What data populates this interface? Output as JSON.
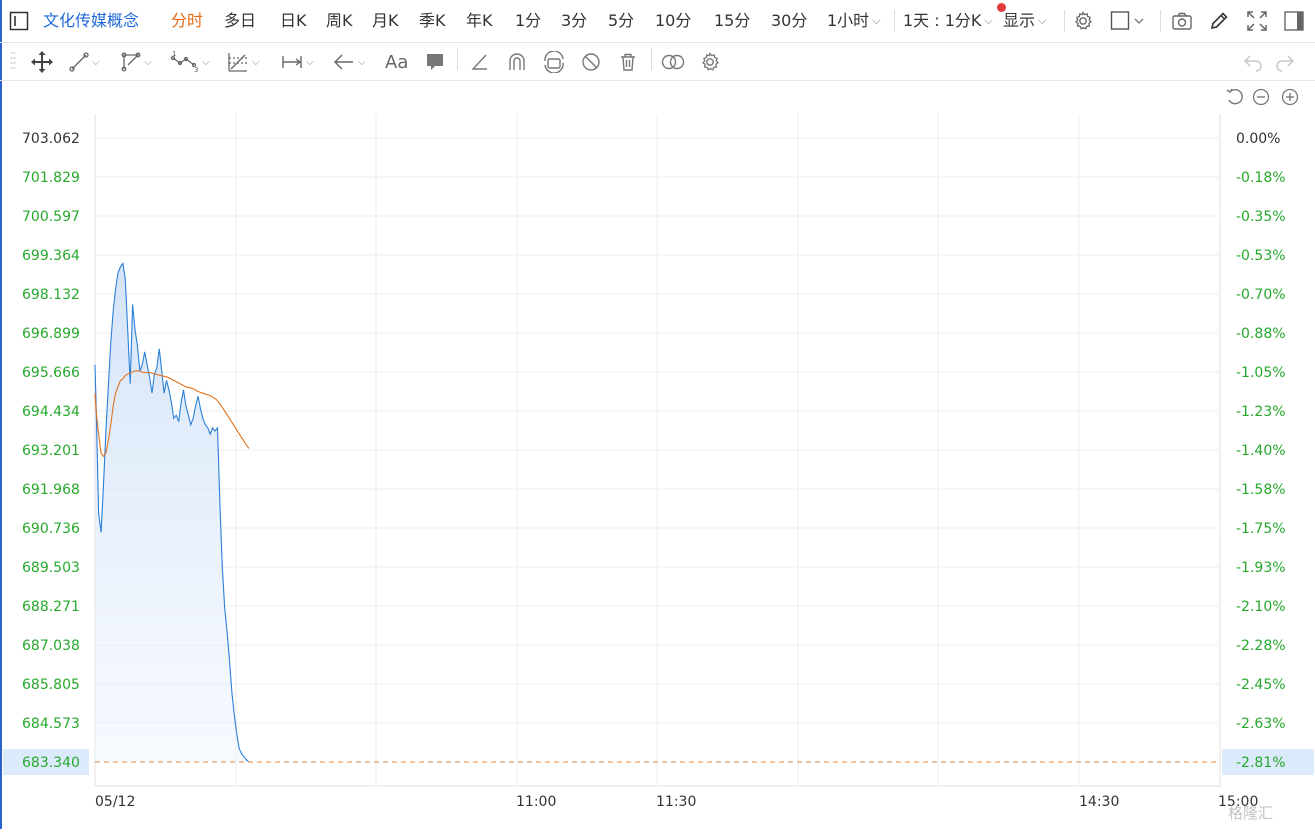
{
  "toolbar": {
    "title": "文化传媒概念",
    "tabs": [
      "分时",
      "多日",
      "日K",
      "周K",
      "月K",
      "季K",
      "年K",
      "1分",
      "3分",
      "5分",
      "10分",
      "15分",
      "30分"
    ],
    "hour_label": "1小时",
    "period_label": "1天 : 1分K",
    "display_label": "显示",
    "colors": {
      "active": "#1f6ad9",
      "selected_tab": "#e56b16",
      "badge": "#e23b3b"
    }
  },
  "drawbar": {
    "icons": [
      "move-icon",
      "line-icon",
      "path-icon",
      "wave-icon",
      "fib-icon",
      "measure-icon",
      "arrow-icon",
      "text-icon",
      "comment-icon",
      "angle-icon",
      "magnet-icon",
      "lock-icon",
      "hide-icon",
      "trash-icon",
      "compare-icon",
      "settings-icon",
      "undo-icon",
      "redo-icon"
    ],
    "text_tool": "Aa"
  },
  "chart_data": {
    "type": "line",
    "title": "",
    "y_left_ticks": [
      "703.062",
      "701.829",
      "700.597",
      "699.364",
      "698.132",
      "696.899",
      "695.666",
      "694.434",
      "693.201",
      "691.968",
      "690.736",
      "689.503",
      "688.271",
      "687.038",
      "685.805",
      "684.573",
      "683.340"
    ],
    "y_right_ticks": [
      "0.00%",
      "-0.18%",
      "-0.35%",
      "-0.53%",
      "-0.70%",
      "-0.88%",
      "-1.05%",
      "-1.23%",
      "-1.40%",
      "-1.58%",
      "-1.75%",
      "-1.93%",
      "-2.10%",
      "-2.28%",
      "-2.45%",
      "-2.63%",
      "-2.81%"
    ],
    "x_ticks": [
      "05/12",
      "11:00",
      "11:30",
      "14:30",
      "15:00"
    ],
    "ylim": [
      683.34,
      703.062
    ],
    "current_value": "683.340",
    "current_pct": "-2.81%",
    "series": [
      {
        "color": "#2b7fd8",
        "fill": true,
        "points": [
          [
            0,
            695.9
          ],
          [
            1,
            694.5
          ],
          [
            2,
            692.9
          ],
          [
            3,
            691.2
          ],
          [
            5,
            690.6
          ],
          [
            7,
            692.1
          ],
          [
            9,
            693.8
          ],
          [
            11,
            695.2
          ],
          [
            13,
            696.6
          ],
          [
            15,
            697.6
          ],
          [
            17,
            698.3
          ],
          [
            19,
            698.8
          ],
          [
            21,
            699.0
          ],
          [
            23,
            699.1
          ],
          [
            25,
            698.6
          ],
          [
            27,
            697.0
          ],
          [
            29,
            695.3
          ],
          [
            31,
            697.8
          ],
          [
            33,
            697.0
          ],
          [
            35,
            696.5
          ],
          [
            37,
            695.7
          ],
          [
            39,
            695.9
          ],
          [
            41,
            696.3
          ],
          [
            43,
            695.9
          ],
          [
            45,
            695.5
          ],
          [
            47,
            695.0
          ],
          [
            49,
            695.6
          ],
          [
            51,
            695.8
          ],
          [
            53,
            696.4
          ],
          [
            55,
            695.7
          ],
          [
            57,
            695.0
          ],
          [
            59,
            695.4
          ],
          [
            61,
            695.1
          ],
          [
            63,
            694.7
          ],
          [
            65,
            694.2
          ],
          [
            67,
            694.3
          ],
          [
            69,
            694.1
          ],
          [
            71,
            694.7
          ],
          [
            73,
            695.1
          ],
          [
            75,
            694.6
          ],
          [
            77,
            694.3
          ],
          [
            79,
            694.0
          ],
          [
            81,
            694.2
          ],
          [
            83,
            694.6
          ],
          [
            85,
            694.9
          ],
          [
            87,
            694.5
          ],
          [
            89,
            694.2
          ],
          [
            91,
            694.0
          ],
          [
            93,
            693.9
          ],
          [
            95,
            693.7
          ],
          [
            97,
            693.9
          ],
          [
            99,
            693.8
          ],
          [
            101,
            693.9
          ],
          [
            103,
            691.5
          ],
          [
            105,
            689.5
          ],
          [
            107,
            688.2
          ],
          [
            109,
            687.4
          ],
          [
            111,
            686.5
          ],
          [
            113,
            685.5
          ],
          [
            115,
            684.8
          ],
          [
            117,
            684.2
          ],
          [
            119,
            683.75
          ],
          [
            121,
            683.6
          ],
          [
            123,
            683.5
          ],
          [
            125,
            683.4
          ],
          [
            127,
            683.34
          ]
        ]
      },
      {
        "color": "#e0731f",
        "fill": false,
        "points": [
          [
            0,
            695.0
          ],
          [
            1,
            694.4
          ],
          [
            3,
            693.7
          ],
          [
            5,
            693.1
          ],
          [
            7,
            693.0
          ],
          [
            9,
            693.1
          ],
          [
            11,
            693.5
          ],
          [
            13,
            694.0
          ],
          [
            15,
            694.6
          ],
          [
            17,
            695.0
          ],
          [
            19,
            695.2
          ],
          [
            21,
            695.4
          ],
          [
            23,
            695.45
          ],
          [
            25,
            695.55
          ],
          [
            27,
            695.6
          ],
          [
            30,
            695.65
          ],
          [
            33,
            695.7
          ],
          [
            36,
            695.7
          ],
          [
            40,
            695.65
          ],
          [
            45,
            695.65
          ],
          [
            50,
            695.6
          ],
          [
            55,
            695.55
          ],
          [
            60,
            695.5
          ],
          [
            65,
            695.4
          ],
          [
            70,
            695.3
          ],
          [
            75,
            695.2
          ],
          [
            80,
            695.15
          ],
          [
            85,
            695.05
          ],
          [
            90,
            694.98
          ],
          [
            95,
            694.92
          ],
          [
            100,
            694.8
          ],
          [
            105,
            694.55
          ],
          [
            110,
            694.25
          ],
          [
            115,
            693.95
          ],
          [
            120,
            693.65
          ],
          [
            125,
            693.35
          ],
          [
            127,
            693.25
          ]
        ]
      }
    ]
  },
  "watermark": "格隆汇"
}
